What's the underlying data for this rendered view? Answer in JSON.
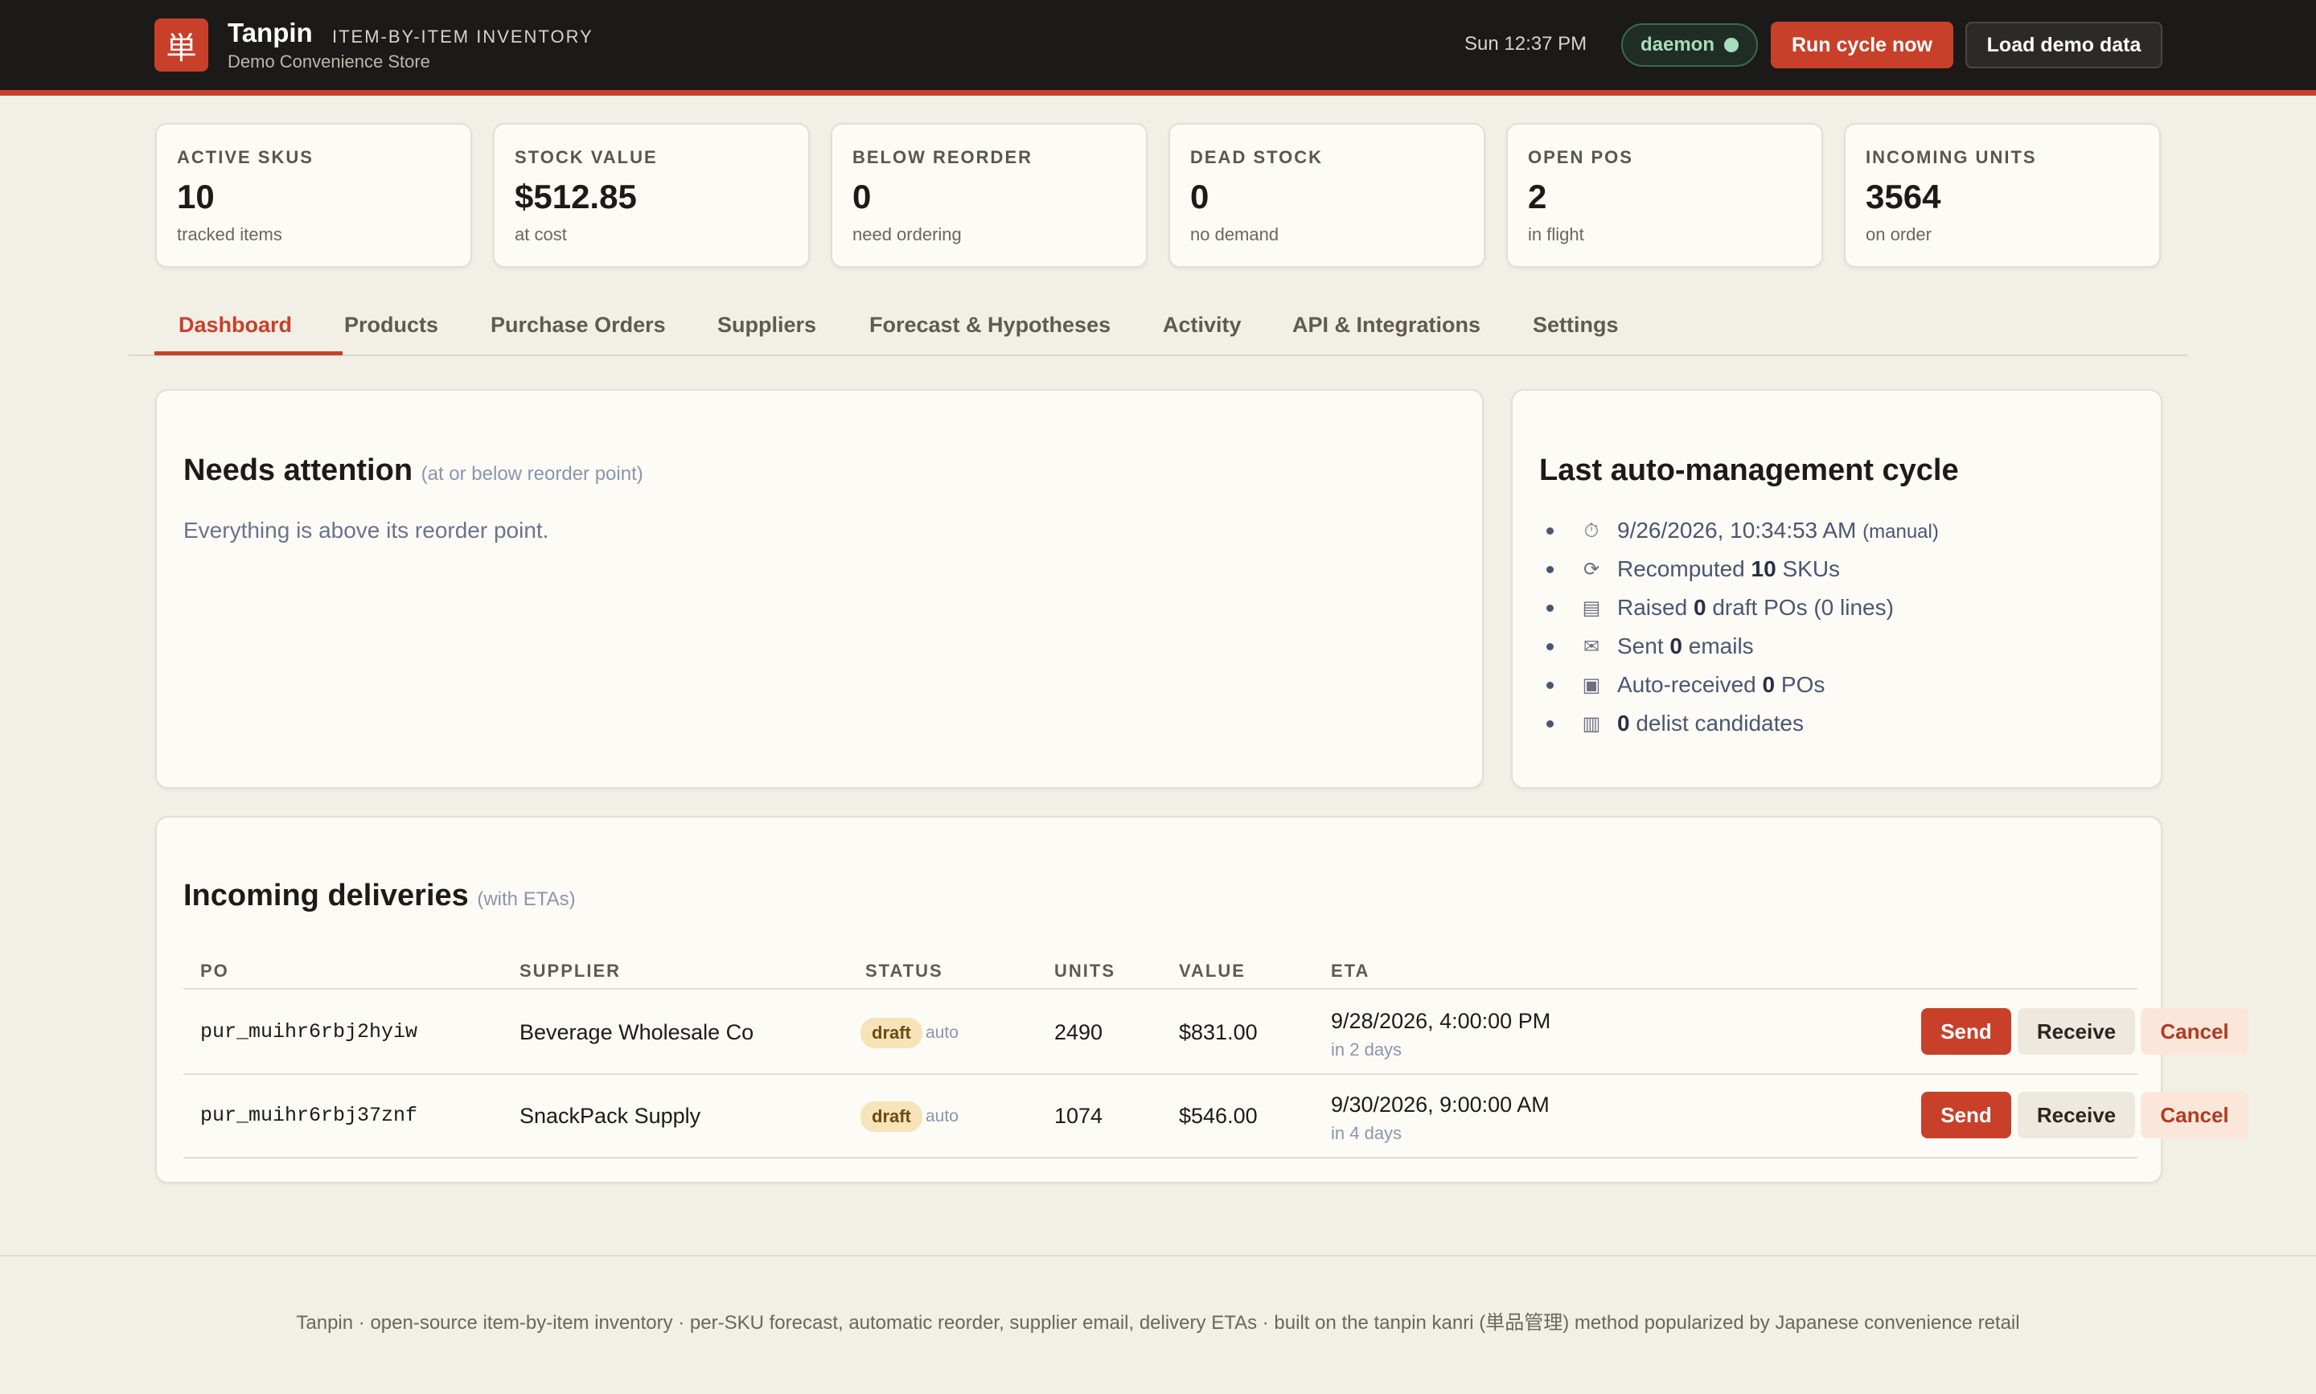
{
  "header": {
    "logo_glyph": "単",
    "app_name": "Tanpin",
    "app_tagline": "ITEM-BY-ITEM INVENTORY",
    "store_name": "Demo Convenience Store",
    "clock": "Sun 12:37 PM",
    "daemon_label": "daemon",
    "run_cycle_label": "Run cycle now",
    "load_demo_label": "Load demo data",
    "accent_color": "#c8402a",
    "daemon_status_color": "#a9dcbc"
  },
  "stats": [
    {
      "label": "ACTIVE SKUS",
      "value": "10",
      "sub": "tracked items"
    },
    {
      "label": "STOCK VALUE",
      "value": "$512.85",
      "sub": "at cost"
    },
    {
      "label": "BELOW REORDER",
      "value": "0",
      "sub": "need ordering"
    },
    {
      "label": "DEAD STOCK",
      "value": "0",
      "sub": "no demand"
    },
    {
      "label": "OPEN POS",
      "value": "2",
      "sub": "in flight"
    },
    {
      "label": "INCOMING UNITS",
      "value": "3564",
      "sub": "on order"
    }
  ],
  "tabs": [
    {
      "label": "Dashboard",
      "active": true
    },
    {
      "label": "Products"
    },
    {
      "label": "Purchase Orders"
    },
    {
      "label": "Suppliers"
    },
    {
      "label": "Forecast & Hypotheses"
    },
    {
      "label": "Activity"
    },
    {
      "label": "API & Integrations"
    },
    {
      "label": "Settings"
    }
  ],
  "attention": {
    "title": "Needs attention",
    "hint": "(at or below reorder point)",
    "message": "Everything is above its reorder point."
  },
  "cycle": {
    "title": "Last auto-management cycle",
    "items": [
      {
        "icon": "stopwatch-icon",
        "glyph": "⏱",
        "pre": "9/26/2026, 10:34:53 AM",
        "bold": "",
        "post": "",
        "hint": "(manual)"
      },
      {
        "icon": "refresh-icon",
        "glyph": "⟳",
        "pre": "Recomputed",
        "bold": "10",
        "post": "SKUs",
        "hint": ""
      },
      {
        "icon": "document-icon",
        "glyph": "▤",
        "pre": "Raised",
        "bold": "0",
        "post": "draft POs (0 lines)",
        "hint": ""
      },
      {
        "icon": "envelope-icon",
        "glyph": "✉",
        "pre": "Sent",
        "bold": "0",
        "post": "emails",
        "hint": ""
      },
      {
        "icon": "package-icon",
        "glyph": "▣",
        "pre": "Auto-received",
        "bold": "0",
        "post": "POs",
        "hint": ""
      },
      {
        "icon": "trash-icon",
        "glyph": "▥",
        "pre": "",
        "bold": "0",
        "post": "delist candidates",
        "hint": ""
      }
    ]
  },
  "deliveries": {
    "title": "Incoming deliveries",
    "hint": "(with ETAs)",
    "columns": [
      "PO",
      "SUPPLIER",
      "STATUS",
      "UNITS",
      "VALUE",
      "ETA"
    ],
    "rows": [
      {
        "po": "pur_muihr6rbj2hyiw",
        "supplier": "Beverage Wholesale Co",
        "status": "draft",
        "status_note": "auto",
        "units": "2490",
        "value": "$831.00",
        "eta": "9/28/2026, 4:00:00 PM",
        "eta_rel": "in 2 days"
      },
      {
        "po": "pur_muihr6rbj37znf",
        "supplier": "SnackPack Supply",
        "status": "draft",
        "status_note": "auto",
        "units": "1074",
        "value": "$546.00",
        "eta": "9/30/2026, 9:00:00 AM",
        "eta_rel": "in 4 days"
      }
    ],
    "actions": {
      "send": "Send",
      "receive": "Receive",
      "cancel": "Cancel"
    }
  },
  "footer": {
    "text": "Tanpin · open-source item-by-item inventory · per-SKU forecast, automatic reorder, supplier email, delivery ETAs · built on the tanpin kanri (単品管理) method popularized by Japanese convenience retail"
  }
}
